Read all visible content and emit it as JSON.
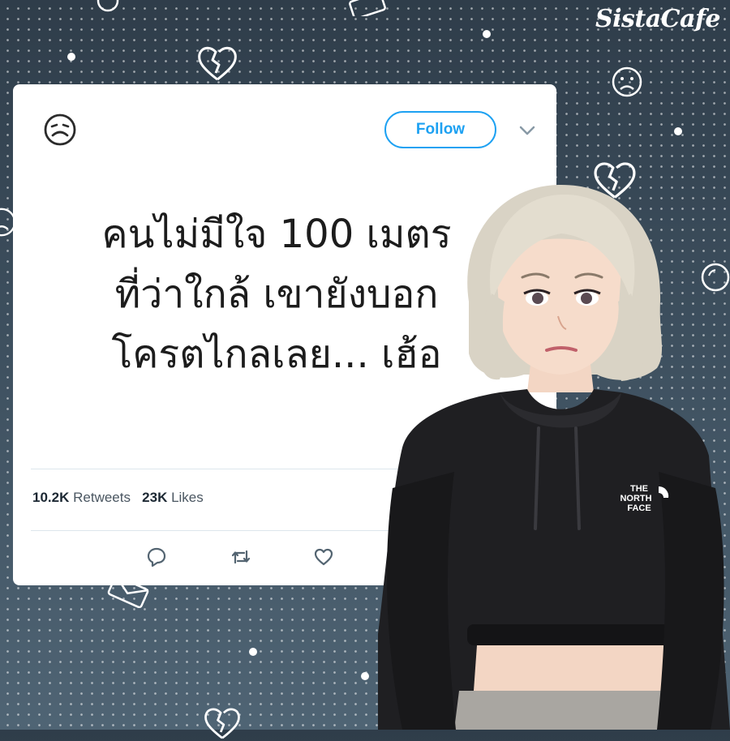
{
  "brand": {
    "logo_text": "SistaCafe"
  },
  "tweet": {
    "follow_label": "Follow",
    "lines": [
      "คนไม่มีใจ 100 เมตร",
      "ที่ว่าใกล้ เขายังบอก",
      "โครตไกลเลย... เฮ้อ"
    ],
    "retweets_count": "10.2K",
    "retweets_label": "Retweets",
    "likes_count": "23K",
    "likes_label": "Likes"
  },
  "hoodie_logo": [
    "THE",
    "NORTH",
    "FACE"
  ],
  "icons": {
    "avatar": "sad-face-icon",
    "menu": "chevron-down-icon",
    "reply": "reply-icon",
    "retweet": "retweet-icon",
    "like": "heart-icon"
  },
  "colors": {
    "accent": "#1da1f2",
    "background": "#3d4f5e",
    "card": "#ffffff",
    "text": "#1c1c1c"
  }
}
